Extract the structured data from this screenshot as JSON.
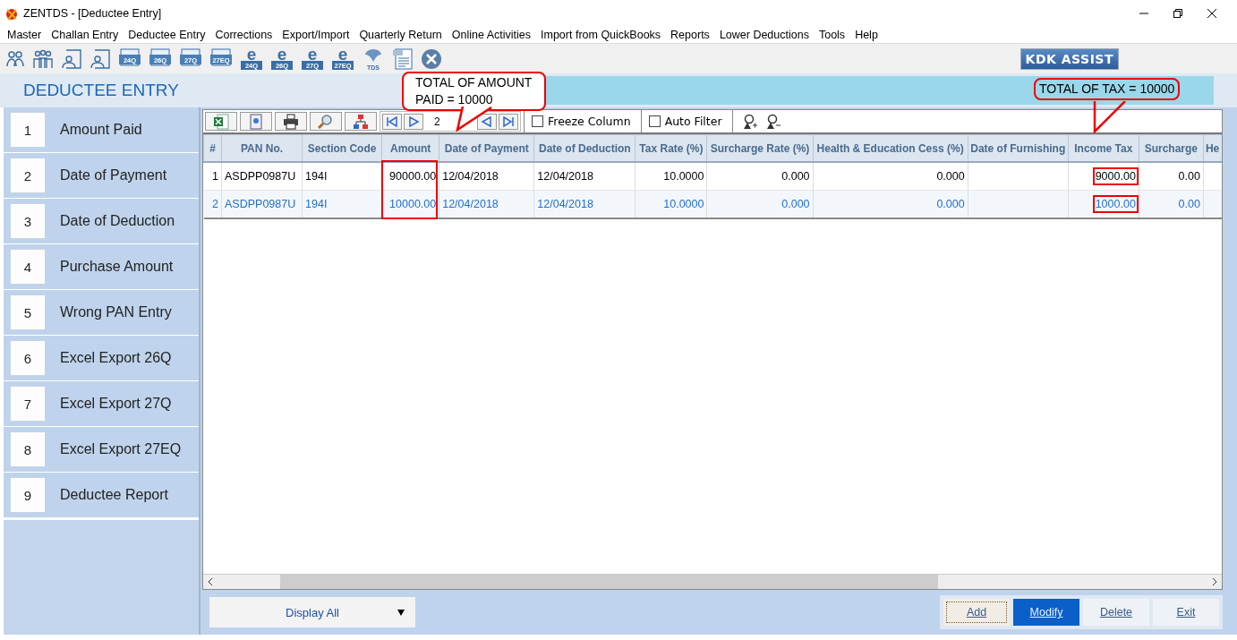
{
  "window": {
    "title": "ZENTDS - [Deductee Entry]"
  },
  "menu": [
    "Master",
    "Challan Entry",
    "Deductee Entry",
    "Corrections",
    "Export/Import",
    "Quarterly Return",
    "Online Activities",
    "Import from QuickBooks",
    "Reports",
    "Lower Deductions",
    "Tools",
    "Help"
  ],
  "toolbar": [
    {
      "kind": "users"
    },
    {
      "kind": "group"
    },
    {
      "kind": "person-form"
    },
    {
      "kind": "person-form"
    },
    {
      "kind": "form",
      "label": "24Q"
    },
    {
      "kind": "form",
      "label": "26Q"
    },
    {
      "kind": "form",
      "label": "27Q"
    },
    {
      "kind": "form",
      "label": "27EQ"
    },
    {
      "kind": "e-form",
      "letter": "e",
      "label": "24Q"
    },
    {
      "kind": "e-form",
      "letter": "e",
      "label": "26Q"
    },
    {
      "kind": "e-form",
      "letter": "e",
      "label": "27Q"
    },
    {
      "kind": "e-form",
      "letter": "e",
      "label": "27EQ"
    },
    {
      "kind": "tds",
      "label": "TDS"
    },
    {
      "kind": "pdf"
    },
    {
      "kind": "close"
    }
  ],
  "assist_button": "KDK ASSIST",
  "heading": "DEDUCTEE ENTRY",
  "callouts": [
    {
      "kind": "amount",
      "text": "TOTAL OF AMOUNT PAID = 10000"
    },
    {
      "kind": "tax",
      "text": "TOTAL OF TAX = 10000"
    }
  ],
  "sidebar": {
    "items": [
      {
        "number": "1",
        "label": "Amount Paid"
      },
      {
        "number": "2",
        "label": "Date of Payment"
      },
      {
        "number": "3",
        "label": "Date of Deduction"
      },
      {
        "number": "4",
        "label": "Purchase Amount"
      },
      {
        "number": "5",
        "label": "Wrong PAN Entry"
      },
      {
        "number": "6",
        "label": "Excel Export 26Q"
      },
      {
        "number": "7",
        "label": "Excel Export 27Q"
      },
      {
        "number": "8",
        "label": "Excel Export 27EQ"
      },
      {
        "number": "9",
        "label": "Deductee Report"
      }
    ]
  },
  "grid_toolbar": {
    "tools": [
      {
        "kind": "excel"
      },
      {
        "kind": "doc"
      },
      {
        "kind": "print"
      },
      {
        "kind": "search"
      },
      {
        "kind": "tree"
      }
    ],
    "page": "2",
    "freeze_column": {
      "label": "Freeze Column",
      "checked": false
    },
    "auto_filter": {
      "label": "Auto Filter",
      "checked": false
    }
  },
  "table": {
    "columns": [
      {
        "label": "#",
        "column_framed": false,
        "cells_framed": false
      },
      {
        "label": "PAN No.",
        "column_framed": false,
        "cells_framed": false
      },
      {
        "label": "Section Code",
        "column_framed": false,
        "cells_framed": false
      },
      {
        "label": "Amount",
        "column_framed": true,
        "cells_framed": false
      },
      {
        "label": "Date of Payment",
        "column_framed": false,
        "cells_framed": false
      },
      {
        "label": "Date of Deduction",
        "column_framed": false,
        "cells_framed": false
      },
      {
        "label": "Tax Rate (%)",
        "column_framed": false,
        "cells_framed": false
      },
      {
        "label": "Surcharge Rate (%)",
        "column_framed": false,
        "cells_framed": false
      },
      {
        "label": "Health & Education Cess (%)",
        "column_framed": false,
        "cells_framed": false
      },
      {
        "label": "Date of Furnishing",
        "column_framed": false,
        "cells_framed": false
      },
      {
        "label": "Income Tax",
        "column_framed": false,
        "cells_framed": true
      },
      {
        "label": "Surcharge",
        "column_framed": false,
        "cells_framed": false
      },
      {
        "label": "He",
        "column_framed": false,
        "cells_framed": false
      }
    ],
    "rows": [
      {
        "selected": false,
        "cells": [
          "1",
          "ASDPP0987U",
          "194I",
          "90000.00",
          "12/04/2018",
          "12/04/2018",
          "10.0000",
          "0.000",
          "0.000",
          "",
          "9000.00",
          "0.00",
          ""
        ]
      },
      {
        "selected": true,
        "cells": [
          "2",
          "ASDPP0987U",
          "194I",
          "10000.00",
          "12/04/2018",
          "12/04/2018",
          "10.0000",
          "0.000",
          "0.000",
          "",
          "1000.00",
          "0.00",
          ""
        ]
      }
    ]
  },
  "filter": {
    "value": "Display All"
  },
  "buttons": [
    {
      "label": "Add",
      "primary": false,
      "focused": true
    },
    {
      "label": "Modify",
      "primary": true,
      "focused": false
    },
    {
      "label": "Delete",
      "primary": false,
      "focused": false
    },
    {
      "label": "Exit",
      "primary": false,
      "focused": false
    }
  ]
}
